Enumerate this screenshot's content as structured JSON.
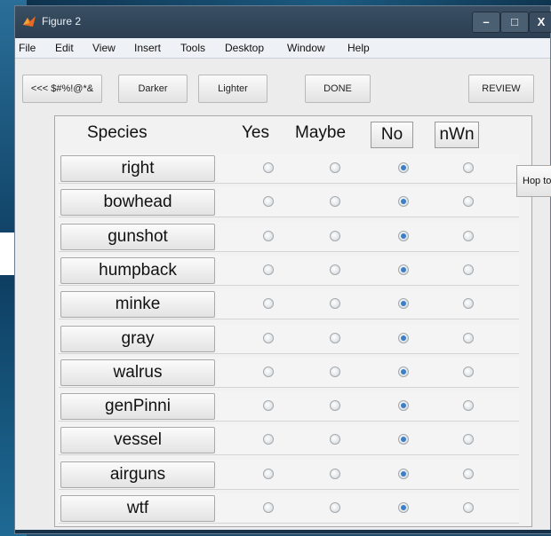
{
  "window": {
    "title": "Figure 2"
  },
  "titlebar_buttons": {
    "minimize": "–",
    "maximize": "□",
    "close": "X"
  },
  "menu": [
    "File",
    "Edit",
    "View",
    "Insert",
    "Tools",
    "Desktop",
    "Window",
    "Help"
  ],
  "toolbar": {
    "back": "<<< $#%!@*&",
    "darker": "Darker",
    "lighter": "Lighter",
    "done": "DONE",
    "review": "REVIEW"
  },
  "header": {
    "species": "Species",
    "yes": "Yes",
    "maybe": "Maybe",
    "no": "No",
    "nwn": "nWn"
  },
  "side_button": "Hop to",
  "rows": [
    {
      "species": "right",
      "selected": "No"
    },
    {
      "species": "bowhead",
      "selected": "No"
    },
    {
      "species": "gunshot",
      "selected": "No"
    },
    {
      "species": "humpback",
      "selected": "No"
    },
    {
      "species": "minke",
      "selected": "No"
    },
    {
      "species": "gray",
      "selected": "No"
    },
    {
      "species": "walrus",
      "selected": "No"
    },
    {
      "species": "genPinni",
      "selected": "No"
    },
    {
      "species": "vessel",
      "selected": "No"
    },
    {
      "species": "airguns",
      "selected": "No"
    },
    {
      "species": "wtf",
      "selected": "No"
    }
  ],
  "colors": {
    "titlebar": "#2b3e52",
    "radio_selected": "#3a7fc7",
    "panel": "#ececec"
  }
}
